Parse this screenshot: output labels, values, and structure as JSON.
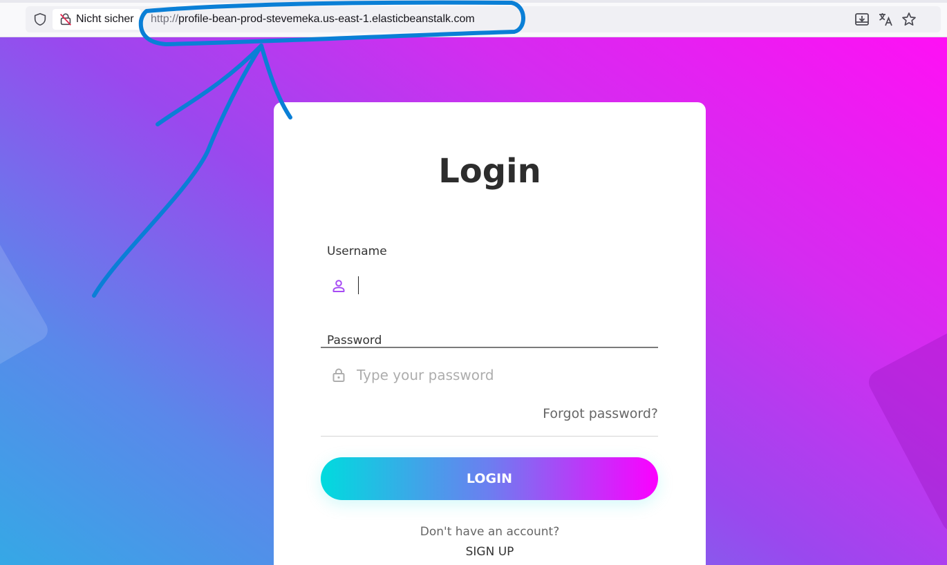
{
  "browser": {
    "security_label": "Nicht sicher",
    "url_protocol": "http://",
    "url_host": "profile-bean-prod-stevemeka.us-east-1.elasticbeanstalk.com"
  },
  "login": {
    "title": "Login",
    "username_label": "Username",
    "username_value": "",
    "password_label": "Password",
    "password_placeholder": "Type your password",
    "forgot_password": "Forgot password?",
    "login_button": "LOGIN",
    "no_account_text": "Don't have an account?",
    "signup_link": "SIGN UP"
  },
  "colors": {
    "annotation_blue": "#0a7fd6",
    "gradient_start": "#00dbde",
    "gradient_end": "#fc00ff",
    "icon_purple": "#a64bf4"
  }
}
